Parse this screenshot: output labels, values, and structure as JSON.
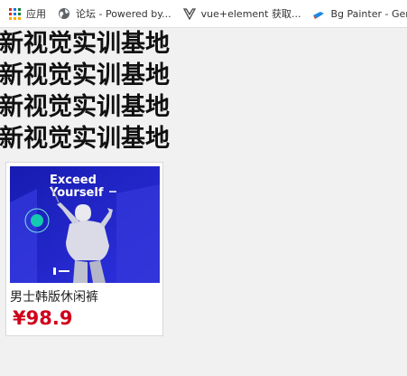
{
  "bookmarks": [
    {
      "label": "应用",
      "icon": "apps-grid-icon"
    },
    {
      "label": "论坛 - Powered by...",
      "icon": "globe-icon"
    },
    {
      "label": "vue+element 获取...",
      "icon": "vue-icon"
    },
    {
      "label": "Bg Painter - Gene...",
      "icon": "paint-icon"
    },
    {
      "label": "",
      "icon": "bookmark-icon"
    }
  ],
  "headings": [
    "新视觉实训基地",
    "新视觉实训基地",
    "新视觉实训基地",
    "新视觉实训基地"
  ],
  "product": {
    "image_text_line1": "Exceed",
    "image_text_line2": "Yourself",
    "name": "男士韩版休闲裤",
    "price": "¥98.9"
  },
  "colors": {
    "price": "#d0021b",
    "image_bg": "#1f22c8"
  }
}
